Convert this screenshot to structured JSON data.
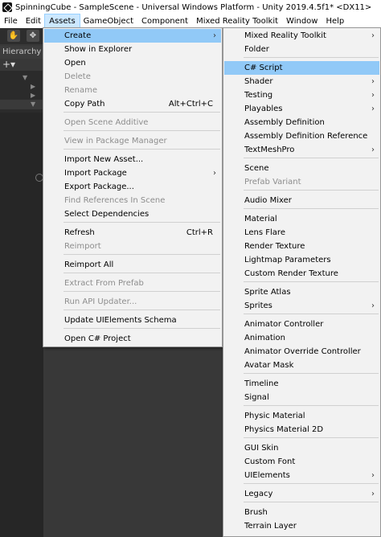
{
  "titlebar": {
    "title": "SpinningCube - SampleScene - Universal Windows Platform - Unity 2019.4.5f1* <DX11>",
    "icon": "unity-icon"
  },
  "menubar": {
    "items": [
      "File",
      "Edit",
      "Assets",
      "GameObject",
      "Component",
      "Mixed Reality Toolkit",
      "Window",
      "Help"
    ],
    "active": "Assets"
  },
  "hierarchy": {
    "tab_label": "Hierarchy",
    "add_label": "+▾"
  },
  "assets_menu": [
    {
      "label": "Create",
      "submenu": true,
      "highlighted": true
    },
    {
      "label": "Show in Explorer"
    },
    {
      "label": "Open"
    },
    {
      "label": "Delete",
      "disabled": true
    },
    {
      "label": "Rename",
      "disabled": true
    },
    {
      "label": "Copy Path",
      "shortcut": "Alt+Ctrl+C"
    },
    {
      "label": "Open Scene Additive",
      "disabled": true
    },
    {
      "label": "View in Package Manager",
      "disabled": true
    },
    {
      "label": "Import New Asset..."
    },
    {
      "label": "Import Package",
      "submenu": true
    },
    {
      "label": "Export Package..."
    },
    {
      "label": "Find References In Scene",
      "disabled": true
    },
    {
      "label": "Select Dependencies"
    },
    {
      "label": "Refresh",
      "shortcut": "Ctrl+R"
    },
    {
      "label": "Reimport",
      "disabled": true
    },
    {
      "label": "Reimport All"
    },
    {
      "label": "Extract From Prefab",
      "disabled": true
    },
    {
      "label": "Run API Updater...",
      "disabled": true
    },
    {
      "label": "Update UIElements Schema"
    },
    {
      "label": "Open C# Project"
    }
  ],
  "create_menu": [
    {
      "label": "Mixed Reality Toolkit",
      "submenu": true
    },
    {
      "label": "Folder"
    },
    {
      "label": "C# Script",
      "highlighted": true
    },
    {
      "label": "Shader",
      "submenu": true
    },
    {
      "label": "Testing",
      "submenu": true
    },
    {
      "label": "Playables",
      "submenu": true
    },
    {
      "label": "Assembly Definition"
    },
    {
      "label": "Assembly Definition Reference"
    },
    {
      "label": "TextMeshPro",
      "submenu": true
    },
    {
      "label": "Scene"
    },
    {
      "label": "Prefab Variant",
      "disabled": true
    },
    {
      "label": "Audio Mixer"
    },
    {
      "label": "Material"
    },
    {
      "label": "Lens Flare"
    },
    {
      "label": "Render Texture"
    },
    {
      "label": "Lightmap Parameters"
    },
    {
      "label": "Custom Render Texture"
    },
    {
      "label": "Sprite Atlas"
    },
    {
      "label": "Sprites",
      "submenu": true
    },
    {
      "label": "Animator Controller"
    },
    {
      "label": "Animation"
    },
    {
      "label": "Animator Override Controller"
    },
    {
      "label": "Avatar Mask"
    },
    {
      "label": "Timeline"
    },
    {
      "label": "Signal"
    },
    {
      "label": "Physic Material"
    },
    {
      "label": "Physics Material 2D"
    },
    {
      "label": "GUI Skin"
    },
    {
      "label": "Custom Font"
    },
    {
      "label": "UIElements",
      "submenu": true
    },
    {
      "label": "Legacy",
      "submenu": true
    },
    {
      "label": "Brush"
    },
    {
      "label": "Terrain Layer"
    }
  ],
  "submenu_glyph": "›"
}
